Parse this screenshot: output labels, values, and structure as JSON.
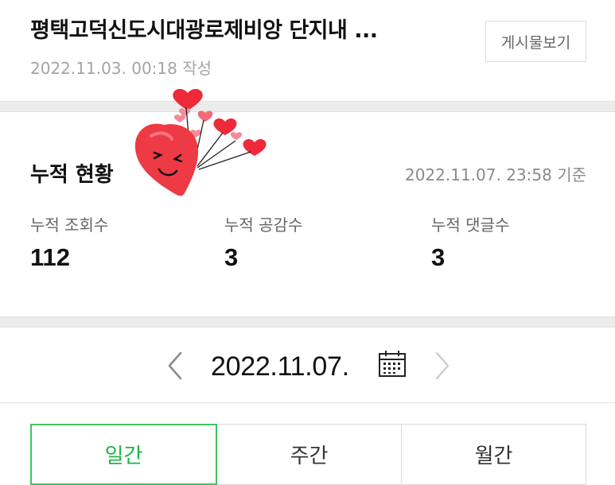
{
  "post": {
    "title": "평택고덕신도시대광로제비앙 단지내 ...",
    "written_date": "2022.11.03. 00:18 작성",
    "view_post_button": "게시물보기"
  },
  "cumulative": {
    "title": "누적 현황",
    "basis_time": "2022.11.07. 23:58 기준",
    "stats": [
      {
        "label": "누적 조회수",
        "value": "112"
      },
      {
        "label": "누적 공감수",
        "value": "3"
      },
      {
        "label": "누적 댓글수",
        "value": "3"
      }
    ]
  },
  "date_nav": {
    "current_date": "2022.11.07.",
    "prev_icon": "chevron-left-icon",
    "next_icon": "chevron-right-icon",
    "calendar_icon": "calendar-icon"
  },
  "period_tabs": [
    {
      "label": "일간",
      "active": true
    },
    {
      "label": "주간",
      "active": false
    },
    {
      "label": "월간",
      "active": false
    }
  ],
  "colors": {
    "accent_green": "#1db54a",
    "heart_red": "#ee3a45",
    "muted_text": "#a4a4a4"
  }
}
